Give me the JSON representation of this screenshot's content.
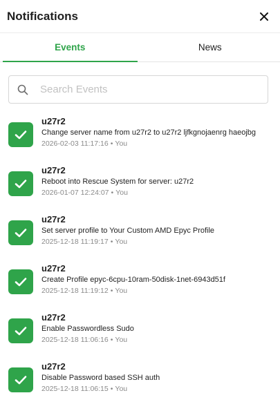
{
  "header": {
    "title": "Notifications",
    "close_icon": "close-icon"
  },
  "tabs": [
    {
      "label": "Events",
      "active": true
    },
    {
      "label": "News",
      "active": false
    }
  ],
  "search": {
    "placeholder": "Search Events",
    "value": "",
    "icon": "search-icon"
  },
  "colors": {
    "accent": "#2fa44a"
  },
  "events": [
    {
      "server": "u27r2",
      "message": "Change server name from u27r2 to u27r2 ljfkgnojaenrg haeojbg",
      "time": "2026-02-03 11:17:16",
      "by": "You",
      "icon": "check-icon"
    },
    {
      "server": "u27r2",
      "message": "Reboot into Rescue System for server: u27r2",
      "time": "2026-01-07 12:24:07",
      "by": "You",
      "icon": "check-icon"
    },
    {
      "server": "u27r2",
      "message": "Set server profile to Your Custom AMD Epyc Profile",
      "time": "2025-12-18 11:19:17",
      "by": "You",
      "icon": "check-icon"
    },
    {
      "server": "u27r2",
      "message": "Create Profile epyc-6cpu-10ram-50disk-1net-6943d51f",
      "time": "2025-12-18 11:19:12",
      "by": "You",
      "icon": "check-icon"
    },
    {
      "server": "u27r2",
      "message": "Enable Passwordless Sudo",
      "time": "2025-12-18 11:06:16",
      "by": "You",
      "icon": "check-icon"
    },
    {
      "server": "u27r2",
      "message": "Disable Password based SSH auth",
      "time": "2025-12-18 11:06:15",
      "by": "You",
      "icon": "check-icon"
    }
  ]
}
